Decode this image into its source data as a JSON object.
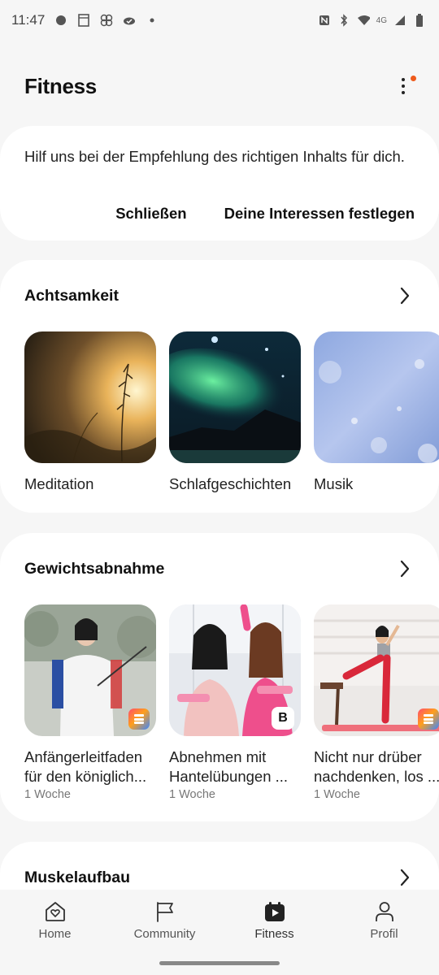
{
  "status_bar": {
    "time": "11:47",
    "network": "4G"
  },
  "header": {
    "title": "Fitness",
    "more_icon": "more-vertical-icon",
    "notification_color": "#ee5a1b"
  },
  "recommendation": {
    "text": "Hilf uns bei der Empfehlung des richtigen Inhalts für dich.",
    "close_label": "Schließen",
    "set_interests_label": "Deine Interessen festlegen"
  },
  "sections": [
    {
      "title": "Achtsamkeit",
      "items": [
        {
          "title": "Meditation"
        },
        {
          "title": "Schlafgeschichten"
        },
        {
          "title": "Musik"
        }
      ]
    },
    {
      "title": "Gewichtsabnahme",
      "items": [
        {
          "title": "Anfängerleitfaden für den königlich...",
          "duration": "1 Woche"
        },
        {
          "title": "Abnehmen mit Hantelübungen ...",
          "duration": "1 Woche"
        },
        {
          "title": "Nicht nur drüber nachdenken, los ...",
          "duration": "1 Woche"
        }
      ]
    },
    {
      "title": "Muskelaufbau"
    }
  ],
  "bottom_nav": [
    {
      "label": "Home",
      "icon": "home-heart-icon"
    },
    {
      "label": "Community",
      "icon": "flag-icon"
    },
    {
      "label": "Fitness",
      "icon": "play-calendar-icon",
      "active": true
    },
    {
      "label": "Profil",
      "icon": "person-icon"
    }
  ]
}
